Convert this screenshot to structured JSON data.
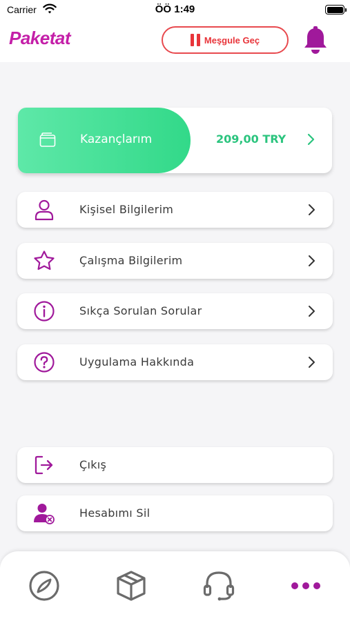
{
  "status_bar": {
    "carrier": "Carrier",
    "time": "ÖÖ 1:49"
  },
  "header": {
    "logo": "Paketat",
    "busy_button_label": "Meşgule Geç"
  },
  "earnings": {
    "label": "Kazançlarım",
    "amount": "209,00 TRY"
  },
  "menu": [
    {
      "label": "Kişisel Bilgilerim",
      "icon": "user-icon"
    },
    {
      "label": "Çalışma Bilgilerim",
      "icon": "star-icon"
    },
    {
      "label": "Sıkça Sorulan Sorular",
      "icon": "info-icon"
    },
    {
      "label": "Uygulama Hakkında",
      "icon": "question-icon"
    }
  ],
  "account_actions": [
    {
      "label": "Çıkış",
      "icon": "logout-icon"
    },
    {
      "label": "Hesabımı Sil",
      "icon": "delete-account-icon"
    }
  ],
  "tabs": [
    {
      "icon": "compass-icon",
      "active": false
    },
    {
      "icon": "package-icon",
      "active": false
    },
    {
      "icon": "headset-icon",
      "active": false
    },
    {
      "icon": "more-icon",
      "active": true
    }
  ],
  "colors": {
    "brand": "#c41fa8",
    "accent_green": "#32d989",
    "busy_red": "#e8343a",
    "icon_purple": "#a0199b"
  }
}
